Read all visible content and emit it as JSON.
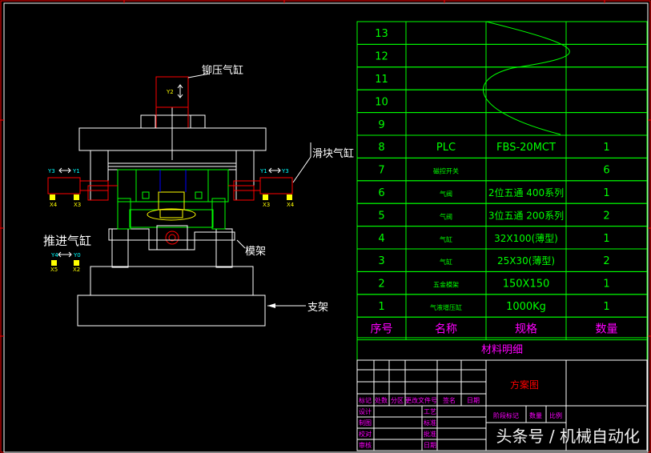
{
  "labels": {
    "press_cylinder": "铆压气缸",
    "slider_cylinder": "滑块气缸",
    "push_cylinder": "推进气缸",
    "die_frame": "模架",
    "support_frame": "支架",
    "y2": "Y2",
    "y3_left": "Y3",
    "y1_left": "Y1",
    "y1_right": "Y1",
    "y3_right": "Y3",
    "x4_left": "X4",
    "x3_left": "X3",
    "x3_right": "X3",
    "x4_right": "X4",
    "y4": "Y4",
    "y0": "Y0",
    "x5": "X5",
    "x2": "X2"
  },
  "bom": {
    "rows": [
      {
        "no": "13",
        "name": "",
        "spec": "",
        "qty": ""
      },
      {
        "no": "12",
        "name": "",
        "spec": "",
        "qty": ""
      },
      {
        "no": "11",
        "name": "",
        "spec": "",
        "qty": ""
      },
      {
        "no": "10",
        "name": "",
        "spec": "",
        "qty": ""
      },
      {
        "no": "9",
        "name": "",
        "spec": "",
        "qty": ""
      },
      {
        "no": "8",
        "name": "PLC",
        "spec": "FBS-20MCT",
        "qty": "1"
      },
      {
        "no": "7",
        "name": "磁控开关",
        "spec": "",
        "qty": "6"
      },
      {
        "no": "6",
        "name": "气阀",
        "spec": "2位五通 400系列",
        "qty": "1"
      },
      {
        "no": "5",
        "name": "气阀",
        "spec": "3位五通 200系列",
        "qty": "2"
      },
      {
        "no": "4",
        "name": "气缸",
        "spec": "32X100(薄型)",
        "qty": "1"
      },
      {
        "no": "3",
        "name": "气缸",
        "spec": "25X30(薄型)",
        "qty": "2"
      },
      {
        "no": "2",
        "name": "五金模架",
        "spec": "150X150",
        "qty": "1"
      },
      {
        "no": "1",
        "name": "气液增压缸",
        "spec": "1000Kg",
        "qty": "1"
      }
    ],
    "header": {
      "no": "序号",
      "name": "名称",
      "spec": "规格",
      "qty": "数量"
    },
    "title": "材料明细"
  },
  "title_block": {
    "drawing_name": "方案图",
    "rev_row": [
      "标记",
      "处数",
      "分区",
      "更改文件号",
      "签名",
      "日期"
    ],
    "sign_rows": [
      [
        "设计",
        "",
        "工艺"
      ],
      [
        "制图",
        "",
        "标准"
      ],
      [
        "校对",
        "",
        "批准"
      ],
      [
        "审核",
        "",
        "日期"
      ]
    ],
    "stage_row": [
      "阶段标记",
      "数量",
      "比例"
    ]
  },
  "colors": {
    "green": "#00ff00",
    "red": "#ff0000",
    "white": "#ffffff",
    "yellow": "#ffff00",
    "magenta": "#ff00ff",
    "blue": "#0000ff",
    "cyan": "#00ffff"
  },
  "watermark": "头条号 / 机械自动化"
}
